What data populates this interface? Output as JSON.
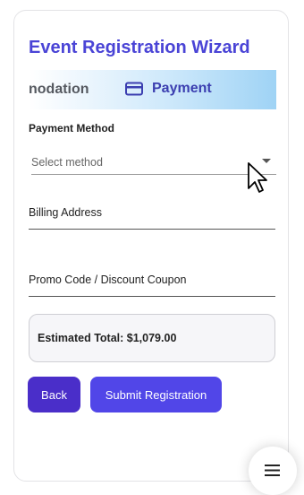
{
  "wizard": {
    "title": "Event Registration Wizard",
    "steps": {
      "previous_label": "nodation",
      "current_label": "Payment",
      "current_icon": "credit-card-icon"
    }
  },
  "form": {
    "payment_method": {
      "label": "Payment Method",
      "placeholder": "Select method"
    },
    "billing_address": {
      "placeholder": "Billing Address",
      "value": ""
    },
    "promo_code": {
      "placeholder": "Promo Code / Discount Coupon",
      "value": ""
    }
  },
  "summary": {
    "estimated_total": "Estimated Total: $1,079.00"
  },
  "actions": {
    "back_label": "Back",
    "submit_label": "Submit Registration"
  },
  "fab": {
    "icon": "menu-icon"
  },
  "colors": {
    "accent": "#4a44d6",
    "back_button": "#4a2ec9",
    "submit_button": "#5146e8",
    "step_text": "#3b3eb0"
  }
}
